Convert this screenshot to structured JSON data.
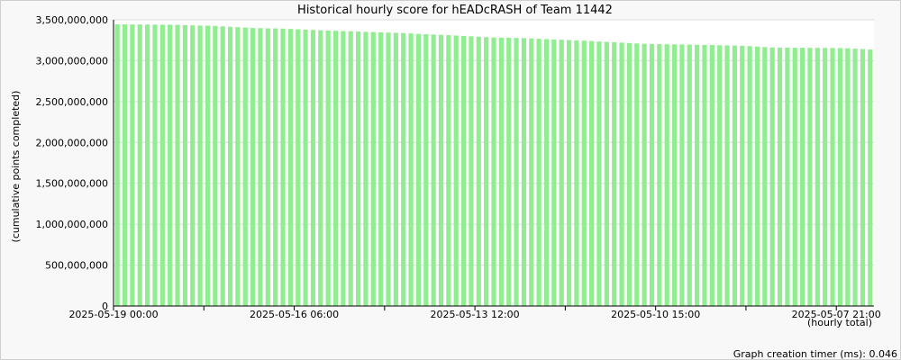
{
  "chart_data": {
    "type": "bar",
    "title": "Historical hourly score for hEADcRASH of Team 11442",
    "ylabel": "(cumulative points completed)",
    "xlabel": "(hourly total)",
    "ylim": [
      0,
      3500000000
    ],
    "yticks": [
      0,
      500000000,
      1000000000,
      1500000000,
      2000000000,
      2500000000,
      3000000000,
      3500000000
    ],
    "ytick_labels": [
      "0",
      "500,000,000",
      "1,000,000,000",
      "1,500,000,000",
      "2,000,000,000",
      "2,500,000,000",
      "3,000,000,000",
      "3,500,000,000"
    ],
    "xtick_labels": [
      "2025-05-19 00:00",
      "2025-05-16 06:00",
      "2025-05-13 12:00",
      "2025-05-10 15:00",
      "2025-05-07 21:00"
    ],
    "bar_color": "#90ee90",
    "grid": true,
    "values": [
      3445000000,
      3444000000,
      3443000000,
      3443000000,
      3442000000,
      3441000000,
      3440000000,
      3440000000,
      3438000000,
      3435000000,
      3432000000,
      3430000000,
      3428000000,
      3425000000,
      3420000000,
      3415000000,
      3410000000,
      3405000000,
      3400000000,
      3398000000,
      3396000000,
      3395000000,
      3392000000,
      3388000000,
      3384000000,
      3380000000,
      3376000000,
      3372000000,
      3368000000,
      3365000000,
      3362000000,
      3360000000,
      3356000000,
      3353000000,
      3350000000,
      3347000000,
      3344000000,
      3341000000,
      3337000000,
      3333000000,
      3328000000,
      3324000000,
      3320000000,
      3316000000,
      3312000000,
      3308000000,
      3303000000,
      3298000000,
      3293000000,
      3288000000,
      3284000000,
      3282000000,
      3280000000,
      3278000000,
      3276000000,
      3272000000,
      3268000000,
      3264000000,
      3260000000,
      3256000000,
      3252000000,
      3248000000,
      3244000000,
      3240000000,
      3235000000,
      3230000000,
      3226000000,
      3221000000,
      3216000000,
      3211000000,
      3207000000,
      3204000000,
      3202000000,
      3200000000,
      3199000000,
      3198000000,
      3197000000,
      3195000000,
      3193000000,
      3191000000,
      3189000000,
      3187000000,
      3185000000,
      3182000000,
      3178000000,
      3172000000,
      3166000000,
      3162000000,
      3160000000,
      3159000000,
      3158000000,
      3158000000,
      3157000000,
      3157000000,
      3156000000,
      3155000000,
      3154000000,
      3152000000,
      3147000000,
      3142000000,
      3137000000
    ]
  },
  "footer": {
    "timer_text": "Graph creation timer (ms): 0.046"
  }
}
